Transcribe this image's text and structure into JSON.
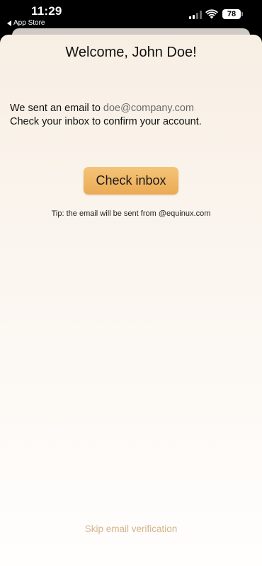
{
  "status_bar": {
    "time": "11:29",
    "back_app": "App Store",
    "battery": "78"
  },
  "sheet": {
    "title": "Welcome, John Doe!",
    "sent_prefix": "We sent an email to",
    "email": "doe@company.com",
    "instruction": "Check your inbox to confirm your account.",
    "check_inbox_label": "Check inbox",
    "tip": "Tip: the email will be sent from @equinux.com",
    "skip_label": "Skip email verification"
  },
  "colors": {
    "accent_button": "#EDB05D",
    "skip_link": "#D4B48A",
    "sheet_background": "#F8EFE4"
  }
}
